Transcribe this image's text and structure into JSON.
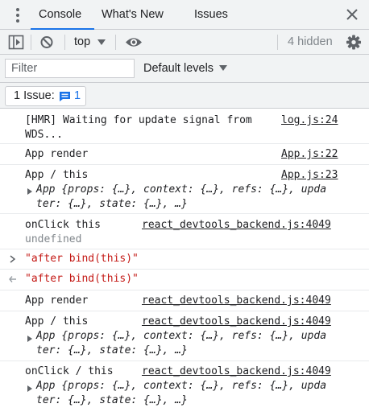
{
  "tabs": {
    "console": "Console",
    "whats_new": "What's New",
    "issues": "Issues"
  },
  "toolbar": {
    "context": "top",
    "hidden": "4 hidden"
  },
  "filter": {
    "placeholder": "Filter",
    "levels": "Default levels"
  },
  "issues_bar": {
    "label": "1 Issue:",
    "count": "1"
  },
  "messages": [
    {
      "text": "[HMR] Waiting for update signal from WDS...",
      "source": "log.js:24"
    },
    {
      "text": "App render",
      "source": "App.js:22"
    },
    {
      "text": "App / this",
      "source": "App.js:23",
      "obj1": "App {props: {…}, context: {…}, refs: {…}, upda",
      "obj2": "ter: {…}, state: {…}, …}"
    },
    {
      "text": "onClick this",
      "source": "react_devtools_backend.js:4049",
      "value": "undefined"
    },
    {
      "input": "\"after bind(this)\""
    },
    {
      "result": "\"after bind(this)\""
    },
    {
      "text": "App render",
      "source": "react_devtools_backend.js:4049"
    },
    {
      "text": "App / this",
      "source": "react_devtools_backend.js:4049",
      "obj1": "App {props: {…}, context: {…}, refs: {…}, upda",
      "obj2": "ter: {…}, state: {…}, …}"
    },
    {
      "text": "onClick / this",
      "source": "react_devtools_backend.js:4049",
      "obj1": "App {props: {…}, context: {…}, refs: {…}, upda",
      "obj2": "ter: {…}, state: {…}, …}"
    }
  ],
  "colors": {
    "accent": "#1a73e8",
    "string": "#c41a16",
    "toolbar_bg": "#f1f3f4"
  }
}
